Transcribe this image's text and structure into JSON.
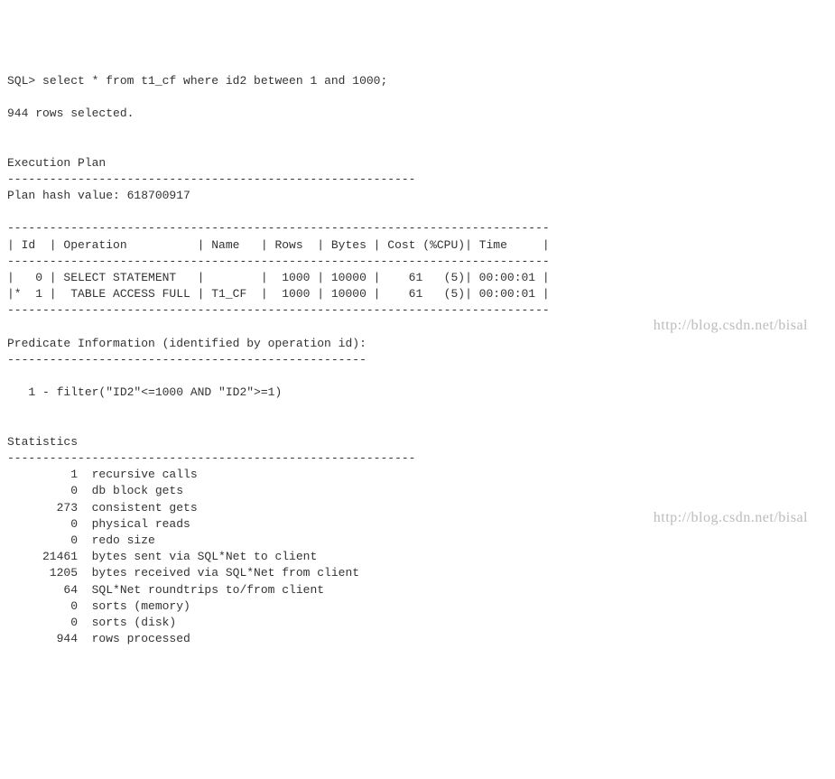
{
  "prompt": "SQL> ",
  "command": "select * from t1_cf where id2 between 1 and 1000;",
  "rows_selected_line": "944 rows selected.",
  "exec_plan_header": "Execution Plan",
  "exec_plan_dash": "----------------------------------------------------------",
  "plan_hash_line": "Plan hash value: 618700917",
  "plan_divider": "-----------------------------------------------------------------------------",
  "plan_header_row": "| Id  | Operation          | Name   | Rows  | Bytes | Cost (%CPU)| Time     |",
  "plan_rows": [
    "|   0 | SELECT STATEMENT   |        |  1000 | 10000 |    61   (5)| 00:00:01 |",
    "|*  1 |  TABLE ACCESS FULL | T1_CF  |  1000 | 10000 |    61   (5)| 00:00:01 |"
  ],
  "predicate_header": "Predicate Information (identified by operation id):",
  "predicate_dash": "---------------------------------------------------",
  "predicate_line": "   1 - filter(\"ID2\"<=1000 AND \"ID2\">=1)",
  "stats_header": "Statistics",
  "stats_dash": "----------------------------------------------------------",
  "stats": [
    {
      "value": 1,
      "label": "recursive calls"
    },
    {
      "value": 0,
      "label": "db block gets"
    },
    {
      "value": 273,
      "label": "consistent gets"
    },
    {
      "value": 0,
      "label": "physical reads"
    },
    {
      "value": 0,
      "label": "redo size"
    },
    {
      "value": 21461,
      "label": "bytes sent via SQL*Net to client"
    },
    {
      "value": 1205,
      "label": "bytes received via SQL*Net from client"
    },
    {
      "value": 64,
      "label": "SQL*Net roundtrips to/from client"
    },
    {
      "value": 0,
      "label": "sorts (memory)"
    },
    {
      "value": 0,
      "label": "sorts (disk)"
    },
    {
      "value": 944,
      "label": "rows processed"
    }
  ],
  "watermark": "http://blog.csdn.net/bisal"
}
